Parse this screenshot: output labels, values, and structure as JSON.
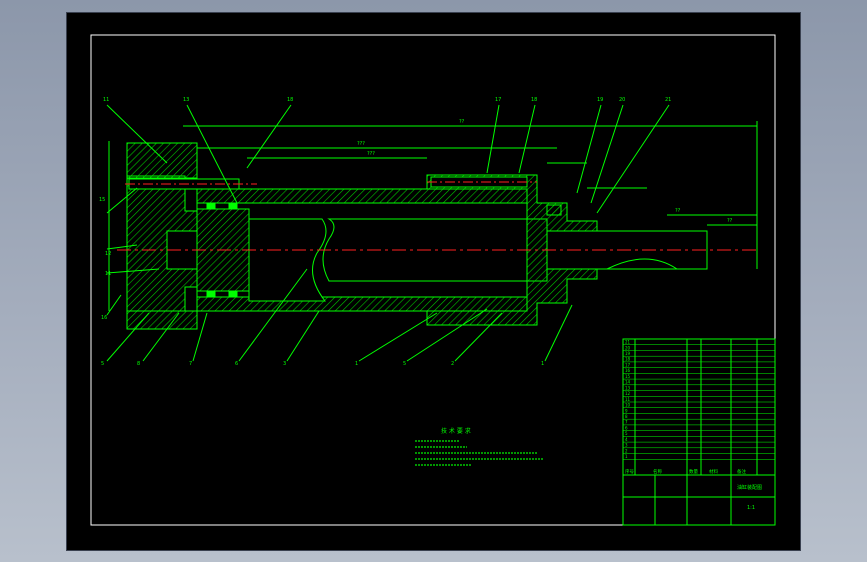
{
  "colors": {
    "background": "#000000",
    "frame": "#ffffff",
    "outline": "#00ff00",
    "hatch": "#00c800",
    "centerline": "#ff2020",
    "window": "#a4adbd"
  },
  "balloons": [
    "11",
    "13",
    "18",
    "17",
    "18",
    "19",
    "20",
    "21",
    "15",
    "12",
    "11",
    "16",
    "5",
    "8",
    "7",
    "6",
    "3",
    "1",
    "5",
    "2",
    "1"
  ],
  "dims": {
    "overall": "??",
    "stroke": "???",
    "inner": "???",
    "rod": "??",
    "rod_end": "??"
  },
  "drawing": {
    "notes_title": "技 术 要 求"
  },
  "parts_list": {
    "item_numbers": [
      "21",
      "20",
      "19",
      "18",
      "17",
      "16",
      "15",
      "14",
      "13",
      "12",
      "11",
      "10",
      "9",
      "8",
      "7",
      "6",
      "5",
      "4",
      "3",
      "2",
      "1"
    ],
    "header": [
      "序号",
      "名称",
      "数量",
      "材料",
      "备注"
    ]
  },
  "title_block": {
    "drawing_name": "油缸装配图",
    "scale": "1:1"
  }
}
